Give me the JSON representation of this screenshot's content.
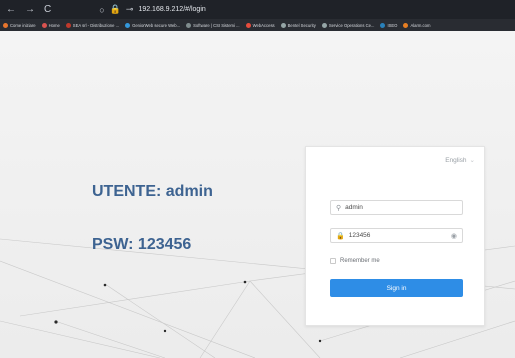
{
  "browser": {
    "nav": {
      "back": "←",
      "forward": "→",
      "reload": "C"
    },
    "address": "192.168.9.212/#/login",
    "bookmarks": [
      {
        "label": "Come iniziare",
        "color": "#e8762d"
      },
      {
        "label": "Home",
        "color": "#d9534f"
      },
      {
        "label": "SEA srl - Distribuzione ...",
        "color": "#c0392b"
      },
      {
        "label": "GeniorWeb secure Web...",
        "color": "#3498db"
      },
      {
        "label": "Software | CSI Sistemi ...",
        "color": "#7f8c8d"
      },
      {
        "label": "WebAccess",
        "color": "#e74c3c"
      },
      {
        "label": "Bentel Security",
        "color": "#95a5a6"
      },
      {
        "label": "Service Operations Ce...",
        "color": "#95a5a6"
      },
      {
        "label": "ISEO",
        "color": "#2980b9"
      },
      {
        "label": "Alarm.com",
        "color": "#e67e22"
      }
    ]
  },
  "overlay": {
    "user_text": "UTENTE: admin",
    "psw_text": "PSW: 123456"
  },
  "login": {
    "language": "English",
    "username_value": "admin",
    "password_value": "123456",
    "remember_label": "Remember me",
    "signin_label": "Sign in"
  },
  "colors": {
    "accent": "#2e8de6",
    "overlay_text": "#3d6391"
  }
}
